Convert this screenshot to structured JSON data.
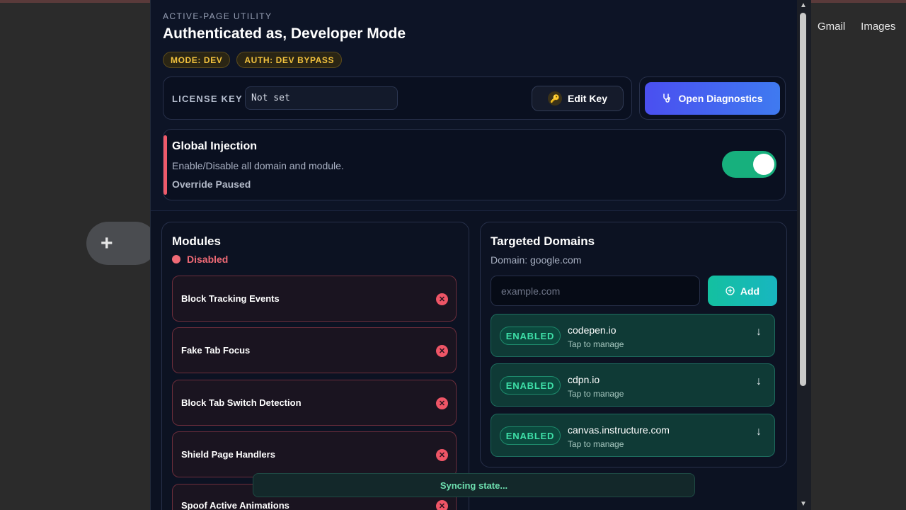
{
  "google_links": {
    "gmail": "Gmail",
    "images": "Images"
  },
  "fab": {
    "label": "+"
  },
  "header": {
    "eyebrow": "ACTIVE-PAGE UTILITY",
    "title": "Authenticated as, Developer Mode",
    "badges": [
      "MODE: DEV",
      "AUTH: DEV BYPASS"
    ]
  },
  "license": {
    "label": "LICENSE KEY",
    "value": "Not set",
    "edit_label": "Edit Key"
  },
  "diagnostics": {
    "label": "Open Diagnostics"
  },
  "injection": {
    "title": "Global Injection",
    "description": "Enable/Disable all domain and module.",
    "status": "Override Paused",
    "enabled": true
  },
  "modules": {
    "title": "Modules",
    "status": "Disabled",
    "items": [
      {
        "label": "Block Tracking Events"
      },
      {
        "label": "Fake Tab Focus"
      },
      {
        "label": "Block Tab Switch Detection"
      },
      {
        "label": "Shield Page Handlers"
      },
      {
        "label": "Spoof Active Animations"
      }
    ]
  },
  "domains": {
    "title": "Targeted Domains",
    "subtitle": "Domain: google.com",
    "input_placeholder": "example.com",
    "add_label": "Add",
    "items": [
      {
        "status": "ENABLED",
        "name": "codepen.io",
        "hint": "Tap to manage"
      },
      {
        "status": "ENABLED",
        "name": "cdpn.io",
        "hint": "Tap to manage"
      },
      {
        "status": "ENABLED",
        "name": "canvas.instructure.com",
        "hint": "Tap to manage"
      }
    ]
  },
  "toast": {
    "text": "Syncing state..."
  },
  "colors": {
    "accent_blue": "#4a4ff0",
    "accent_teal": "#14c0a0",
    "danger": "#ef5a6a",
    "warning": "#f2c23e",
    "success": "#17b07d"
  }
}
